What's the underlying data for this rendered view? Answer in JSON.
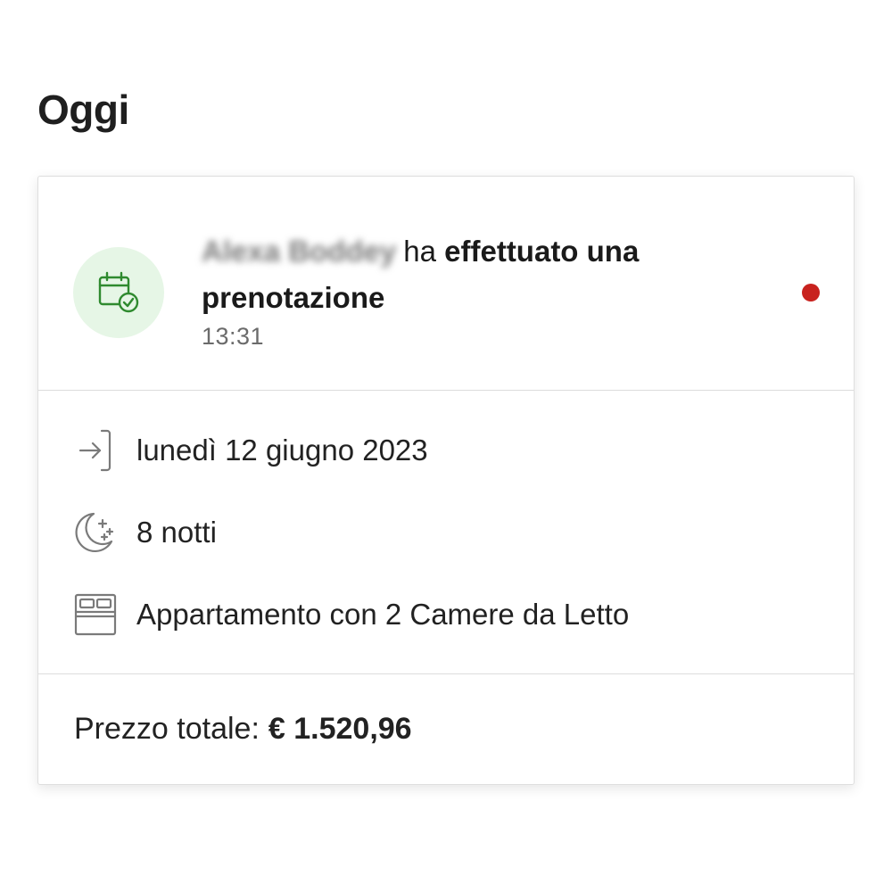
{
  "section": {
    "title": "Oggi"
  },
  "notification": {
    "guest_name": "Alexa Boddey",
    "verb": "ha",
    "action": "effettuato una prenotazione",
    "time": "13:31",
    "icon": "calendar-check-icon",
    "unread": true,
    "colors": {
      "icon_bg": "#e6f6e6",
      "icon": "#2f8a2f",
      "unread_dot": "#c8221e"
    }
  },
  "details": {
    "checkin": {
      "icon": "check-in-arrow-icon",
      "label": "lunedì 12 giugno 2023"
    },
    "nights": {
      "icon": "moon-stars-icon",
      "label": "8 notti"
    },
    "room": {
      "icon": "bed-icon",
      "label": "Appartamento con 2 Camere da Letto"
    }
  },
  "price": {
    "label": "Prezzo totale:",
    "value": "€ 1.520,96"
  }
}
